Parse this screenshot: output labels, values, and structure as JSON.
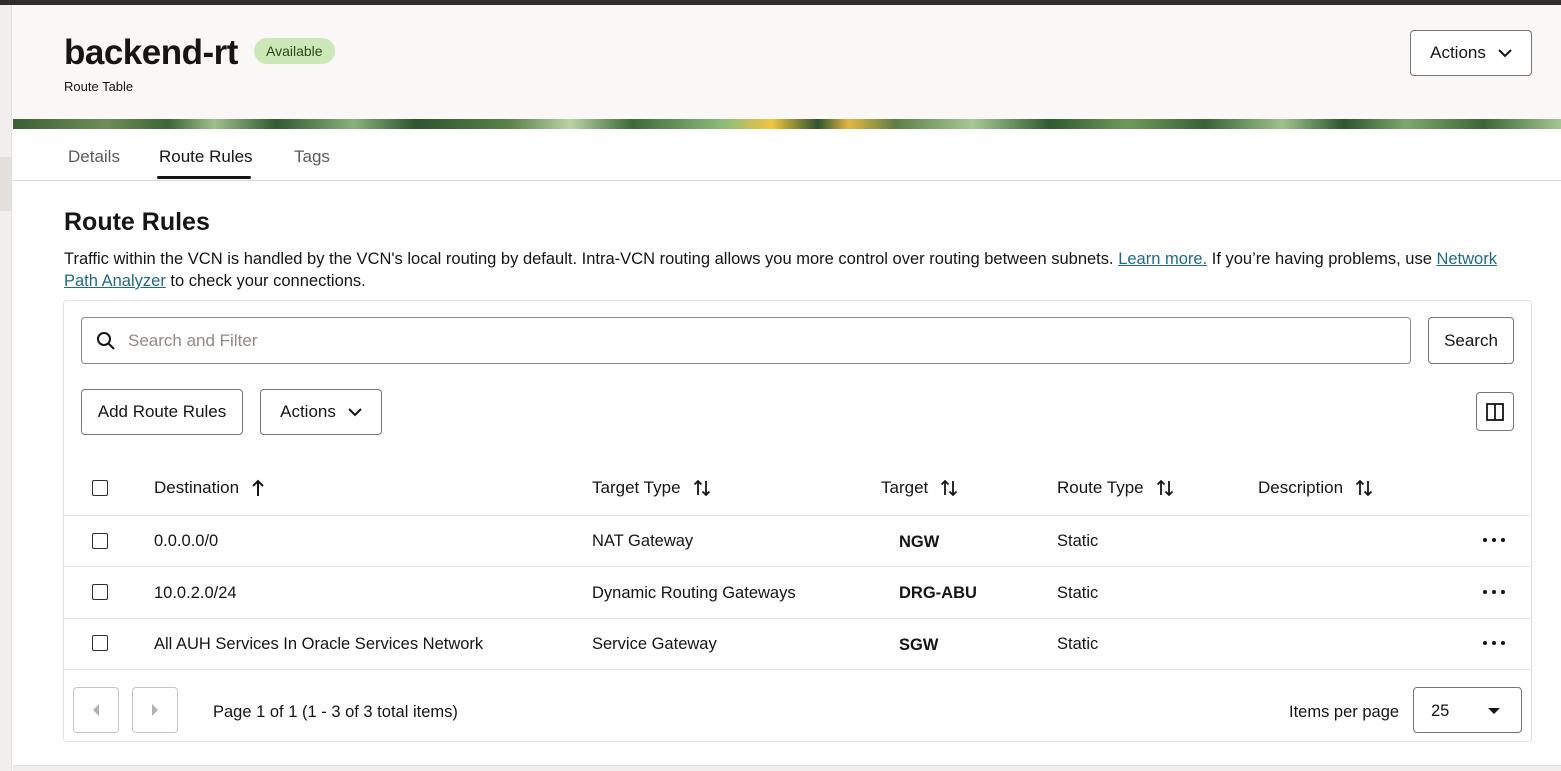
{
  "header": {
    "title": "backend-rt",
    "status": "Available",
    "subtitle": "Route Table",
    "actions_label": "Actions"
  },
  "tabs": [
    {
      "label": "Details",
      "active": false
    },
    {
      "label": "Route Rules",
      "active": true
    },
    {
      "label": "Tags",
      "active": false
    }
  ],
  "section": {
    "title": "Route Rules",
    "description_part1": "Traffic within the VCN is handled by the VCN's local routing by default. Intra-VCN routing allows you more control over routing between subnets.",
    "learn_more": "Learn more.",
    "description_part2": "If you’re having problems, use",
    "network_path_analyzer": "Network Path Analyzer",
    "description_part3": "to check your connections."
  },
  "search": {
    "placeholder": "Search and Filter",
    "value": "",
    "button_label": "Search"
  },
  "toolbar": {
    "add_label": "Add Route Rules",
    "actions_label": "Actions"
  },
  "table": {
    "columns": [
      "Destination",
      "Target Type",
      "Target",
      "Route Type",
      "Description"
    ],
    "rows": [
      {
        "destination": "0.0.0.0/0",
        "target_type": "NAT Gateway",
        "target": "NGW",
        "route_type": "Static",
        "description": ""
      },
      {
        "destination": "10.0.2.0/24",
        "target_type": "Dynamic Routing Gateways",
        "target": "DRG-ABU",
        "route_type": "Static",
        "description": ""
      },
      {
        "destination": "All AUH Services In Oracle Services Network",
        "target_type": "Service Gateway",
        "target": "SGW",
        "route_type": "Static",
        "description": ""
      }
    ]
  },
  "pagination": {
    "summary": "Page 1 of 1 (1 - 3 of 3 total items)",
    "items_per_page_label": "Items per page",
    "items_per_page_value": "25"
  },
  "colors": {
    "status_badge_bg": "#cde8b8",
    "link": "#1f6b86",
    "text": "#161513",
    "topbar": "#312d2a"
  },
  "icons": {
    "search": "magnifier-icon",
    "sort_asc": "arrow-up-icon",
    "sort_both": "sort-arrows-icon",
    "column_toggle": "columns-icon",
    "row_menu": "kebab-horizontal-icon"
  }
}
